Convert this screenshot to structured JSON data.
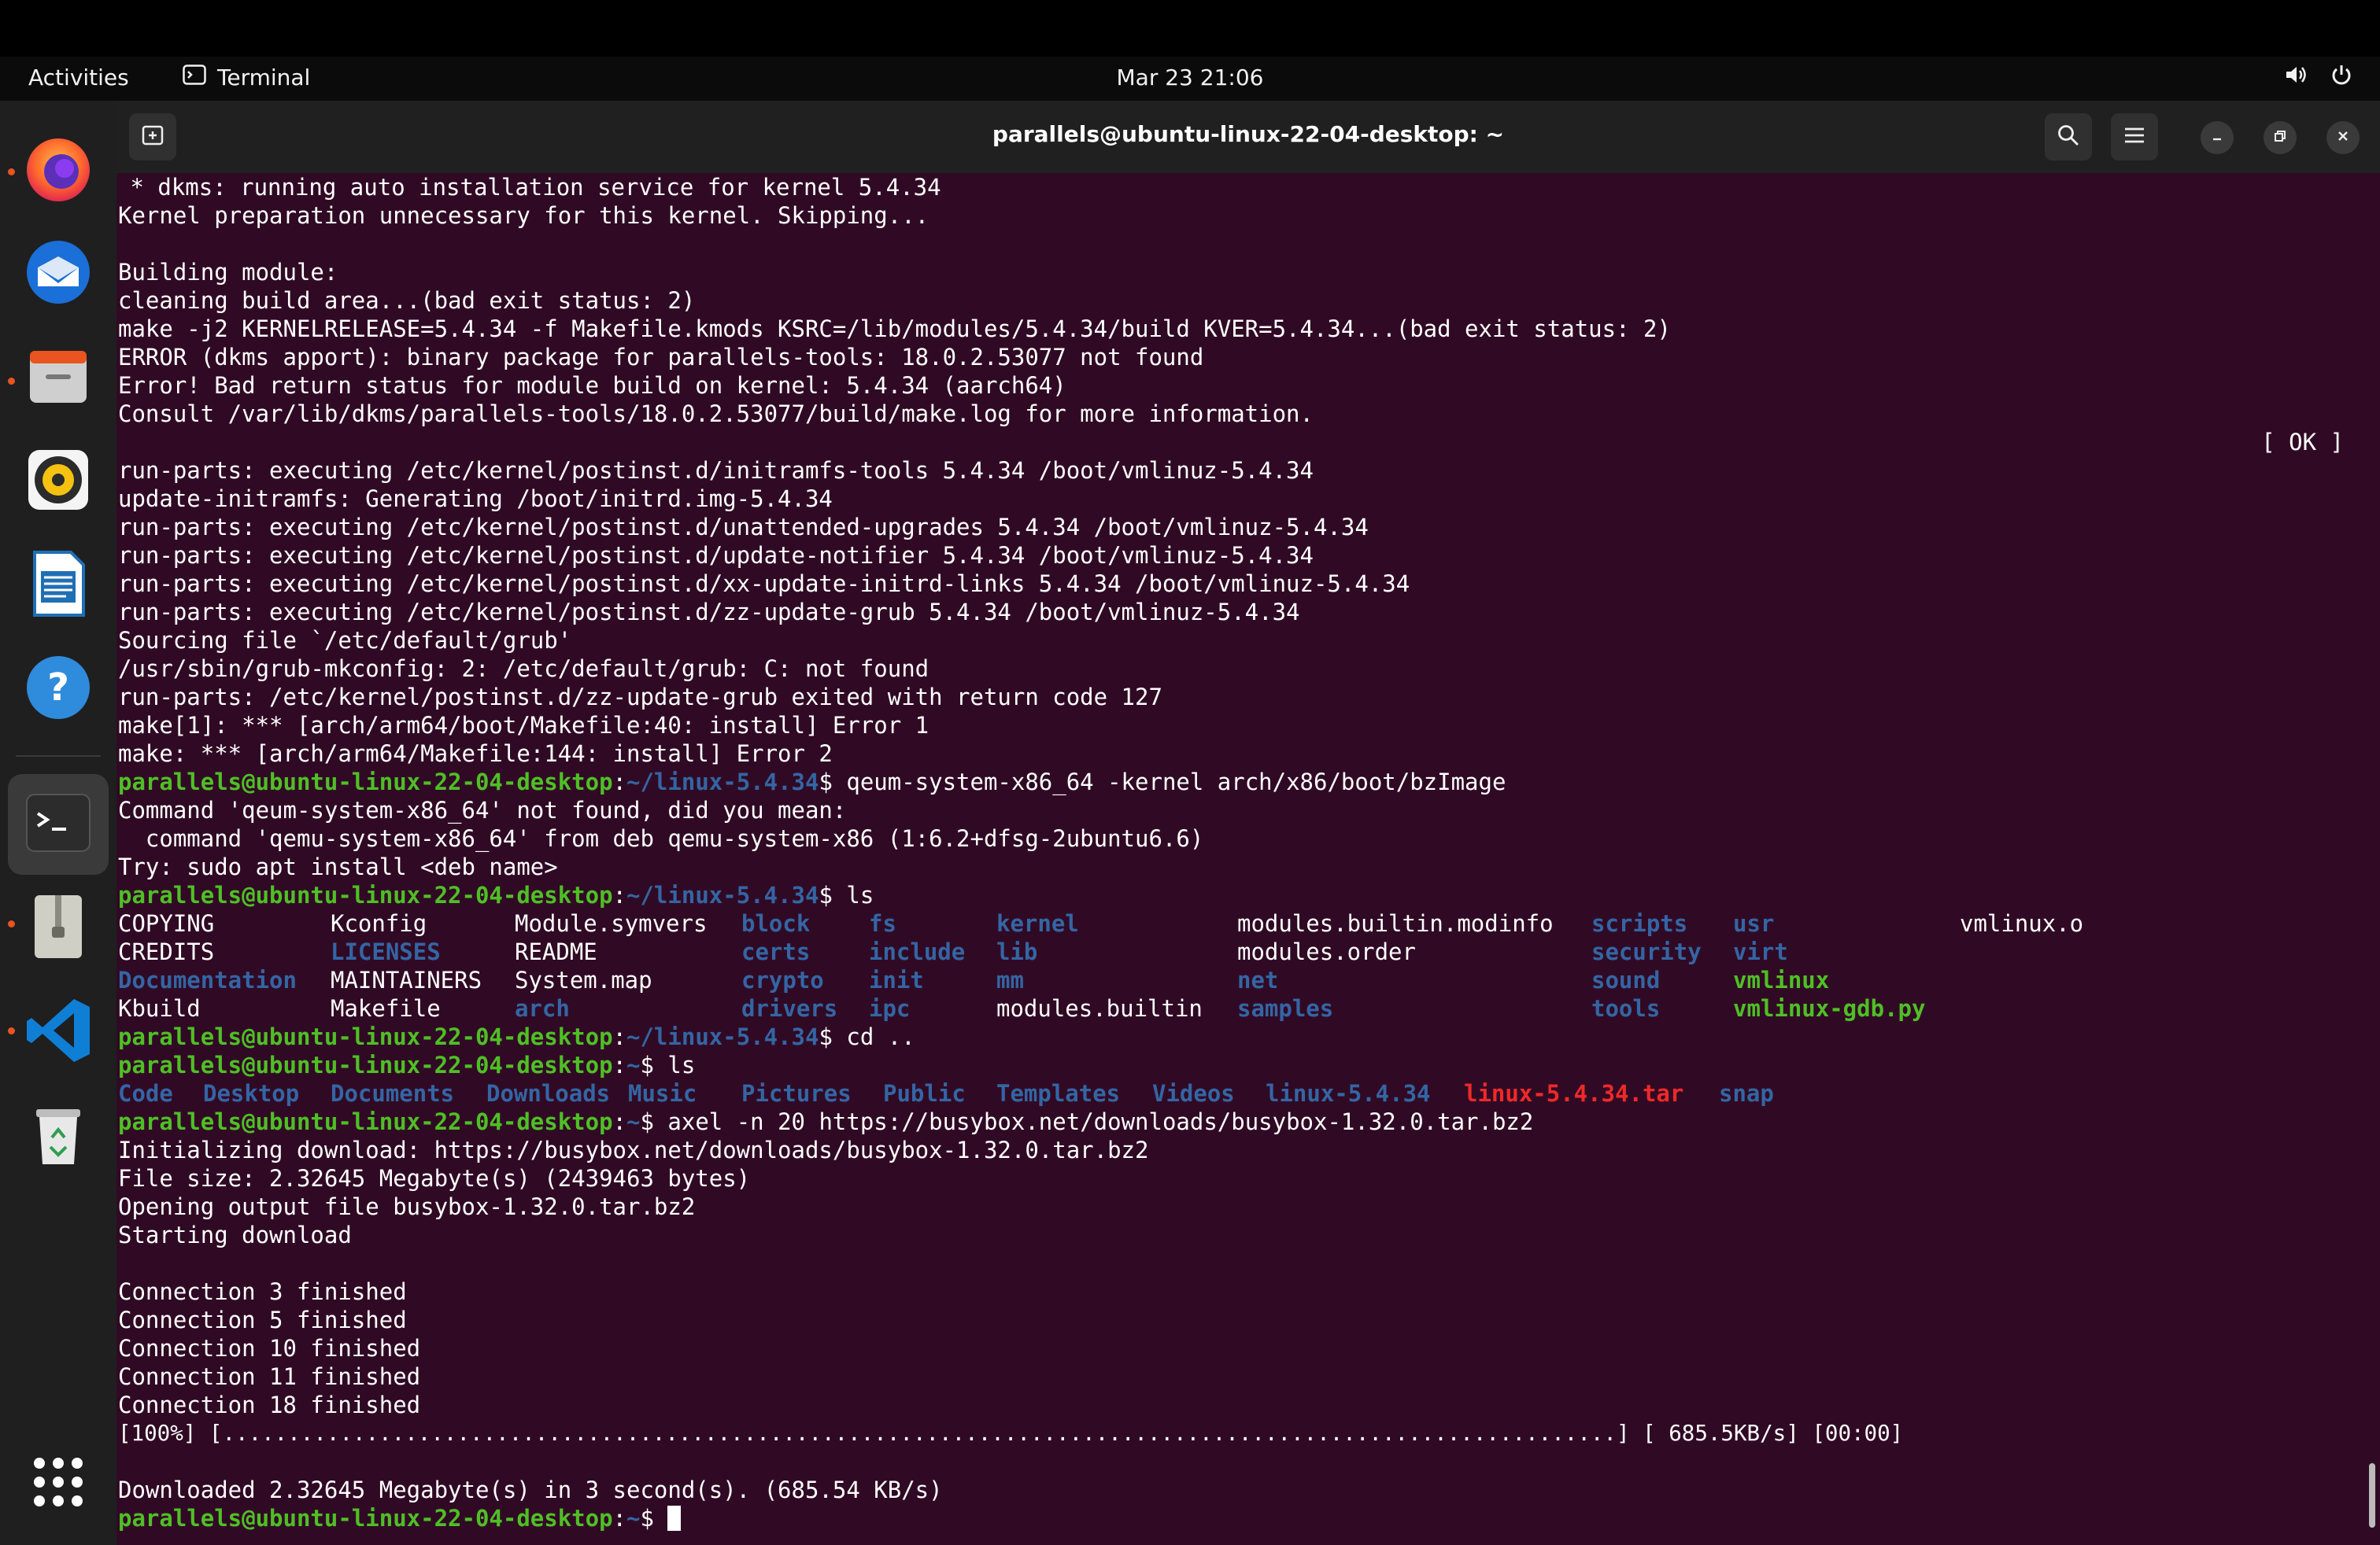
{
  "topbar": {
    "activities": "Activities",
    "app_name": "Terminal",
    "clock": "Mar 23  21:06"
  },
  "dock": {
    "items": [
      {
        "name": "Firefox",
        "icon": "firefox-icon",
        "running": true
      },
      {
        "name": "Thunderbird",
        "icon": "thunderbird-icon",
        "running": false
      },
      {
        "name": "Files",
        "icon": "files-icon",
        "running": true
      },
      {
        "name": "Rhythmbox",
        "icon": "rhythmbox-icon",
        "running": false
      },
      {
        "name": "LibreOffice Writer",
        "icon": "writer-icon",
        "running": false
      },
      {
        "name": "Help",
        "icon": "help-icon",
        "running": false
      },
      {
        "name": "Terminal",
        "icon": "terminal-icon",
        "running": true,
        "active": true
      },
      {
        "name": "Archive",
        "icon": "archive-icon",
        "running": true
      },
      {
        "name": "Visual Studio Code",
        "icon": "vscode-icon",
        "running": true
      },
      {
        "name": "Trash",
        "icon": "trash-icon",
        "running": false
      },
      {
        "name": "Show Applications",
        "icon": "app-grid-icon",
        "running": false
      }
    ]
  },
  "window": {
    "title": "parallels@ubuntu-linux-22-04-desktop: ~"
  },
  "colors": {
    "terminal_bg": "#300a24",
    "prompt_user": "#4fbf26",
    "prompt_path": "#3465a4",
    "archive": "#ef2929",
    "ubuntu_orange": "#e95420"
  },
  "terminal": {
    "prompt_user": "parallels@ubuntu-linux-22-04-desktop",
    "prompt_path_kernel": "~/linux-5.4.34",
    "prompt_path_home": "~",
    "lines": {
      "l0": " * dkms: running auto installation service for kernel 5.4.34",
      "l1": "Kernel preparation unnecessary for this kernel. Skipping...",
      "l2": "",
      "l3": "Building module:",
      "l4": "cleaning build area...(bad exit status: 2)",
      "l5": "make -j2 KERNELRELEASE=5.4.34 -f Makefile.kmods KSRC=/lib/modules/5.4.34/build KVER=5.4.34...(bad exit status: 2)",
      "l6": "ERROR (dkms apport): binary package for parallels-tools: 18.0.2.53077 not found",
      "l7": "Error! Bad return status for module build on kernel: 5.4.34 (aarch64)",
      "l8": "Consult /var/lib/dkms/parallels-tools/18.0.2.53077/build/make.log for more information.",
      "l9_ok": "[ OK ]",
      "l10": "run-parts: executing /etc/kernel/postinst.d/initramfs-tools 5.4.34 /boot/vmlinuz-5.4.34",
      "l11": "update-initramfs: Generating /boot/initrd.img-5.4.34",
      "l12": "run-parts: executing /etc/kernel/postinst.d/unattended-upgrades 5.4.34 /boot/vmlinuz-5.4.34",
      "l13": "run-parts: executing /etc/kernel/postinst.d/update-notifier 5.4.34 /boot/vmlinuz-5.4.34",
      "l14": "run-parts: executing /etc/kernel/postinst.d/xx-update-initrd-links 5.4.34 /boot/vmlinuz-5.4.34",
      "l15": "run-parts: executing /etc/kernel/postinst.d/zz-update-grub 5.4.34 /boot/vmlinuz-5.4.34",
      "l16": "Sourcing file `/etc/default/grub'",
      "l17": "/usr/sbin/grub-mkconfig: 2: /etc/default/grub: C: not found",
      "l18": "run-parts: /etc/kernel/postinst.d/zz-update-grub exited with return code 127",
      "l19": "make[1]: *** [arch/arm64/boot/Makefile:40: install] Error 1",
      "l20": "make: *** [arch/arm64/Makefile:144: install] Error 2",
      "l21_cmd": "$ qeum-system-x86_64 -kernel arch/x86/boot/bzImage",
      "l22": "Command 'qeum-system-x86_64' not found, did you mean:",
      "l23": "  command 'qemu-system-x86_64' from deb qemu-system-x86 (1:6.2+dfsg-2ubuntu6.6)",
      "l24": "Try: sudo apt install <deb name>",
      "l25_cmd": "$ ls",
      "l30_cmd": "$ cd ..",
      "l31_cmd": "$ ls",
      "l33_cmd": "$ axel -n 20 https://busybox.net/downloads/busybox-1.32.0.tar.bz2",
      "l34": "Initializing download: https://busybox.net/downloads/busybox-1.32.0.tar.bz2",
      "l35": "File size: 2.32645 Megabyte(s) (2439463 bytes)",
      "l36": "Opening output file busybox-1.32.0.tar.bz2",
      "l37": "Starting download",
      "l38": "",
      "l39": "Connection 3 finished",
      "l40": "Connection 5 finished",
      "l41": "Connection 10 finished",
      "l42": "Connection 11 finished",
      "l43": "Connection 18 finished",
      "l44": "[100%] [...........................................................................................................] [ 685.5KB/s] [00:00]",
      "l45": "",
      "l46": "Downloaded 2.32645 Megabyte(s) in 3 second(s). (685.54 KB/s)",
      "l47_cmd": "$ "
    },
    "ls_kernel": [
      [
        "COPYING",
        "Kconfig",
        "Module.symvers",
        "block",
        "fs",
        "kernel",
        "modules.builtin.modinfo",
        "scripts",
        "usr",
        "vmlinux.o"
      ],
      [
        "CREDITS",
        "LICENSES",
        "README",
        "certs",
        "include",
        "lib",
        "modules.order",
        "security",
        "virt",
        ""
      ],
      [
        "Documentation",
        "MAINTAINERS",
        "System.map",
        "crypto",
        "init",
        "mm",
        "net",
        "sound",
        "vmlinux",
        ""
      ],
      [
        "Kbuild",
        "Makefile",
        "arch",
        "drivers",
        "ipc",
        "modules.builtin",
        "samples",
        "tools",
        "vmlinux-gdb.py",
        ""
      ]
    ],
    "ls_home": [
      "Code",
      "Desktop",
      "Documents",
      "Downloads",
      "Music",
      "Pictures",
      "Public",
      "Templates",
      "Videos",
      "linux-5.4.34",
      "linux-5.4.34.tar",
      "snap"
    ]
  }
}
